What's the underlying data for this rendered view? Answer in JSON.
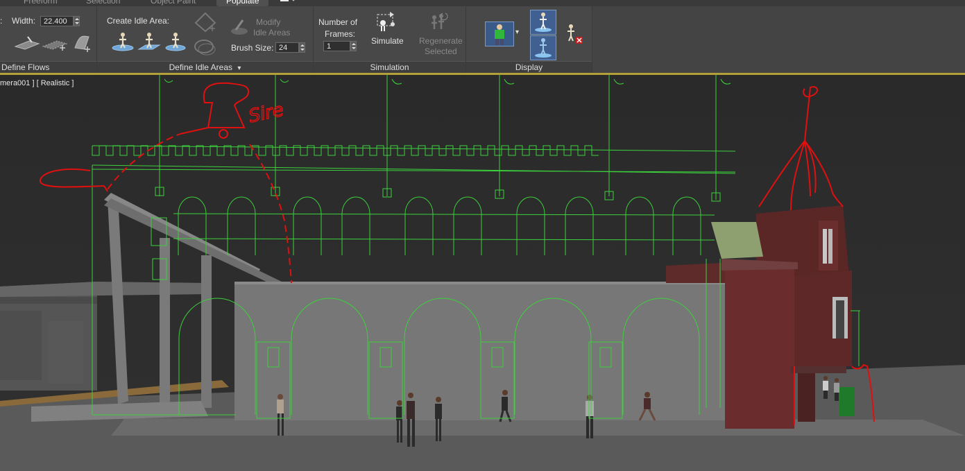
{
  "tabs": [
    {
      "label": "Freeform",
      "active": false
    },
    {
      "label": "Selection",
      "active": false
    },
    {
      "label": "Object Paint",
      "active": false
    },
    {
      "label": "Populate",
      "active": true
    }
  ],
  "define_flows": {
    "width_label": "Width:",
    "width_value": "22.400",
    "footer": "Define Flows"
  },
  "define_idle_areas": {
    "create_label": "Create Idle Area:",
    "modify_label_line1": "Modify",
    "modify_label_line2": "Idle Areas",
    "brush_label": "Brush Size:",
    "brush_value": "24",
    "footer": "Define Idle Areas",
    "footer_arrow": "▾"
  },
  "simulation": {
    "frames_label_line1": "Number of",
    "frames_label_line2": "Frames:",
    "frames_value": "1",
    "simulate_label": "Simulate",
    "regenerate_line1": "Regenerate",
    "regenerate_line2": "Selected",
    "footer": "Simulation"
  },
  "display": {
    "footer": "Display",
    "dropdown_arrow": "▾"
  },
  "viewport": {
    "label": "mera001 ] [ Realistic ]",
    "sketch_text": "Sire"
  },
  "colors": {
    "accent_line": "#b4a038",
    "wireframe": "#3cd23c",
    "sketch": "#e01010"
  },
  "icons": {
    "create_idle": [
      "person-circle-icon",
      "person-circle-icon",
      "person-circle-icon"
    ],
    "simulate": "simulate-icon",
    "display_figure": "green-figure-icon",
    "delete": "delete-people-icon"
  }
}
